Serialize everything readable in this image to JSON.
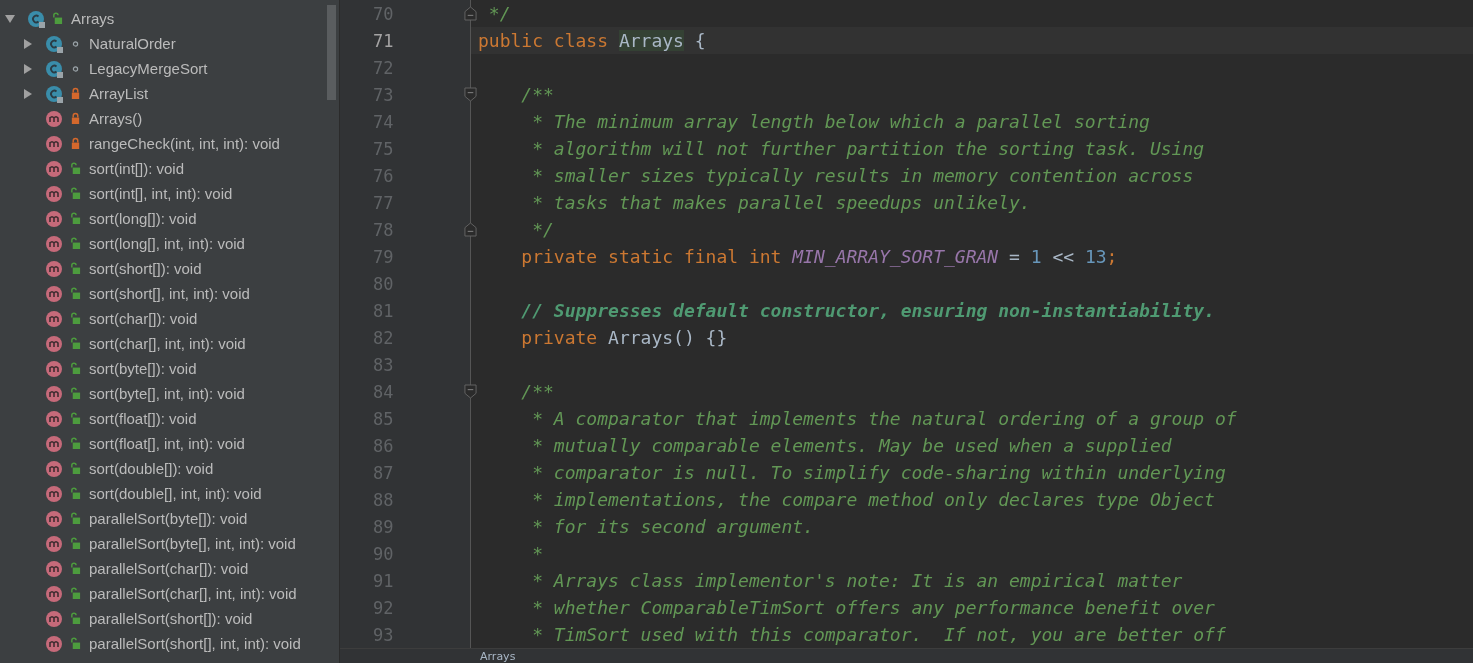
{
  "structure_tree": [
    {
      "name": "Arrays",
      "kind": "class",
      "private": false,
      "expanded": true,
      "selected": false,
      "children": [
        {
          "name": "NaturalOrder",
          "kind": "nested_class",
          "package_private": true,
          "expanded": false,
          "selected": false
        },
        {
          "name": "LegacyMergeSort",
          "kind": "nested_class",
          "package_private": true,
          "expanded": false,
          "selected": false
        },
        {
          "name": "ArrayList",
          "kind": "nested_class",
          "private": true,
          "expanded": false,
          "selected": false
        },
        {
          "name": "Arrays()",
          "kind": "method",
          "private": true,
          "selected": false
        },
        {
          "name": "rangeCheck(int, int, int): void",
          "kind": "method",
          "private": true,
          "selected": false
        },
        {
          "name": "sort(int[]): void",
          "kind": "method",
          "private": false,
          "selected": false
        },
        {
          "name": "sort(int[], int, int): void",
          "kind": "method",
          "private": false,
          "selected": false
        },
        {
          "name": "sort(long[]): void",
          "kind": "method",
          "private": false,
          "selected": false
        },
        {
          "name": "sort(long[], int, int): void",
          "kind": "method",
          "private": false,
          "selected": false
        },
        {
          "name": "sort(short[]): void",
          "kind": "method",
          "private": false,
          "selected": false
        },
        {
          "name": "sort(short[], int, int): void",
          "kind": "method",
          "private": false,
          "selected": false
        },
        {
          "name": "sort(char[]): void",
          "kind": "method",
          "private": false,
          "selected": false
        },
        {
          "name": "sort(char[], int, int): void",
          "kind": "method",
          "private": false,
          "selected": false
        },
        {
          "name": "sort(byte[]): void",
          "kind": "method",
          "private": false,
          "selected": false
        },
        {
          "name": "sort(byte[], int, int): void",
          "kind": "method",
          "private": false,
          "selected": false
        },
        {
          "name": "sort(float[]): void",
          "kind": "method",
          "private": false,
          "selected": false
        },
        {
          "name": "sort(float[], int, int): void",
          "kind": "method",
          "private": false,
          "selected": false
        },
        {
          "name": "sort(double[]): void",
          "kind": "method",
          "private": false,
          "selected": false
        },
        {
          "name": "sort(double[], int, int): void",
          "kind": "method",
          "private": false,
          "selected": false
        },
        {
          "name": "parallelSort(byte[]): void",
          "kind": "method",
          "private": false,
          "selected": false
        },
        {
          "name": "parallelSort(byte[], int, int): void",
          "kind": "method",
          "private": false,
          "selected": false
        },
        {
          "name": "parallelSort(char[]): void",
          "kind": "method",
          "private": false,
          "selected": false
        },
        {
          "name": "parallelSort(char[], int, int): void",
          "kind": "method",
          "private": false,
          "selected": false
        },
        {
          "name": "parallelSort(short[]): void",
          "kind": "method",
          "private": false,
          "selected": false
        },
        {
          "name": "parallelSort(short[], int, int): void",
          "kind": "method",
          "private": false,
          "selected": false
        }
      ]
    }
  ],
  "editor": {
    "lines": [
      {
        "number": "70",
        "current": false,
        "fold_end": true,
        "tokens": [
          {
            "kind": "doc",
            "text": " */"
          }
        ]
      },
      {
        "number": "71",
        "current": true,
        "tokens": [
          {
            "kind": "keyword",
            "text": "public class "
          },
          {
            "kind": "highlight",
            "text": "Arrays"
          },
          {
            "kind": "plain",
            "text": " {"
          }
        ]
      },
      {
        "number": "72",
        "current": false
      },
      {
        "number": "73",
        "current": false,
        "fold_start": true,
        "tokens": [
          {
            "kind": "doc",
            "text": "    /**"
          }
        ]
      },
      {
        "number": "74",
        "current": false,
        "tokens": [
          {
            "kind": "doc",
            "text": "     * The minimum array length below which a parallel sorting"
          }
        ]
      },
      {
        "number": "75",
        "current": false,
        "tokens": [
          {
            "kind": "doc",
            "text": "     * algorithm will not further partition the sorting task. Using"
          }
        ]
      },
      {
        "number": "76",
        "current": false,
        "tokens": [
          {
            "kind": "doc",
            "text": "     * smaller sizes typically results in memory contention across"
          }
        ]
      },
      {
        "number": "77",
        "current": false,
        "tokens": [
          {
            "kind": "doc",
            "text": "     * tasks that makes parallel speedups unlikely."
          }
        ]
      },
      {
        "number": "78",
        "current": false,
        "fold_end": true,
        "tokens": [
          {
            "kind": "doc",
            "text": "     */"
          }
        ]
      },
      {
        "number": "79",
        "current": false,
        "tokens": [
          {
            "kind": "keyword",
            "text": "    private static final int "
          },
          {
            "kind": "constant",
            "text": "MIN_ARRAY_SORT_GRAN"
          },
          {
            "kind": "plain",
            "text": " = "
          },
          {
            "kind": "number",
            "text": "1"
          },
          {
            "kind": "plain",
            "text": " << "
          },
          {
            "kind": "number",
            "text": "13"
          },
          {
            "kind": "keyword",
            "text": ";"
          }
        ]
      },
      {
        "number": "80",
        "current": false
      },
      {
        "number": "81",
        "current": false,
        "tokens": [
          {
            "kind": "comment",
            "text": "    // Suppresses default constructor, ensuring non-instantiability."
          }
        ]
      },
      {
        "number": "82",
        "current": false,
        "tokens": [
          {
            "kind": "keyword",
            "text": "    private "
          },
          {
            "kind": "plain",
            "text": "Arrays() {}"
          }
        ]
      },
      {
        "number": "83",
        "current": false
      },
      {
        "number": "84",
        "current": false,
        "fold_start": true,
        "tokens": [
          {
            "kind": "doc",
            "text": "    /**"
          }
        ]
      },
      {
        "number": "85",
        "current": false,
        "tokens": [
          {
            "kind": "doc",
            "text": "     * A comparator that implements the natural ordering of a group of"
          }
        ]
      },
      {
        "number": "86",
        "current": false,
        "tokens": [
          {
            "kind": "doc",
            "text": "     * mutually comparable elements. May be used when a supplied"
          }
        ]
      },
      {
        "number": "87",
        "current": false,
        "tokens": [
          {
            "kind": "doc",
            "text": "     * comparator is null. To simplify code-sharing within underlying"
          }
        ]
      },
      {
        "number": "88",
        "current": false,
        "tokens": [
          {
            "kind": "doc",
            "text": "     * implementations, the compare method only declares type Object"
          }
        ]
      },
      {
        "number": "89",
        "current": false,
        "tokens": [
          {
            "kind": "doc",
            "text": "     * for its second argument."
          }
        ]
      },
      {
        "number": "90",
        "current": false,
        "tokens": [
          {
            "kind": "doc",
            "text": "     *"
          }
        ]
      },
      {
        "number": "91",
        "current": false,
        "tokens": [
          {
            "kind": "doc",
            "text": "     * Arrays class implementor's note: It is an empirical matter"
          }
        ]
      },
      {
        "number": "92",
        "current": false,
        "tokens": [
          {
            "kind": "doc",
            "text": "     * whether ComparableTimSort offers any performance benefit over"
          }
        ]
      },
      {
        "number": "93",
        "current": false,
        "tokens": [
          {
            "kind": "doc",
            "text": "     * TimSort used with this comparator.  If not, you are better off"
          }
        ]
      }
    ]
  },
  "breadcrumb": "Arrays"
}
